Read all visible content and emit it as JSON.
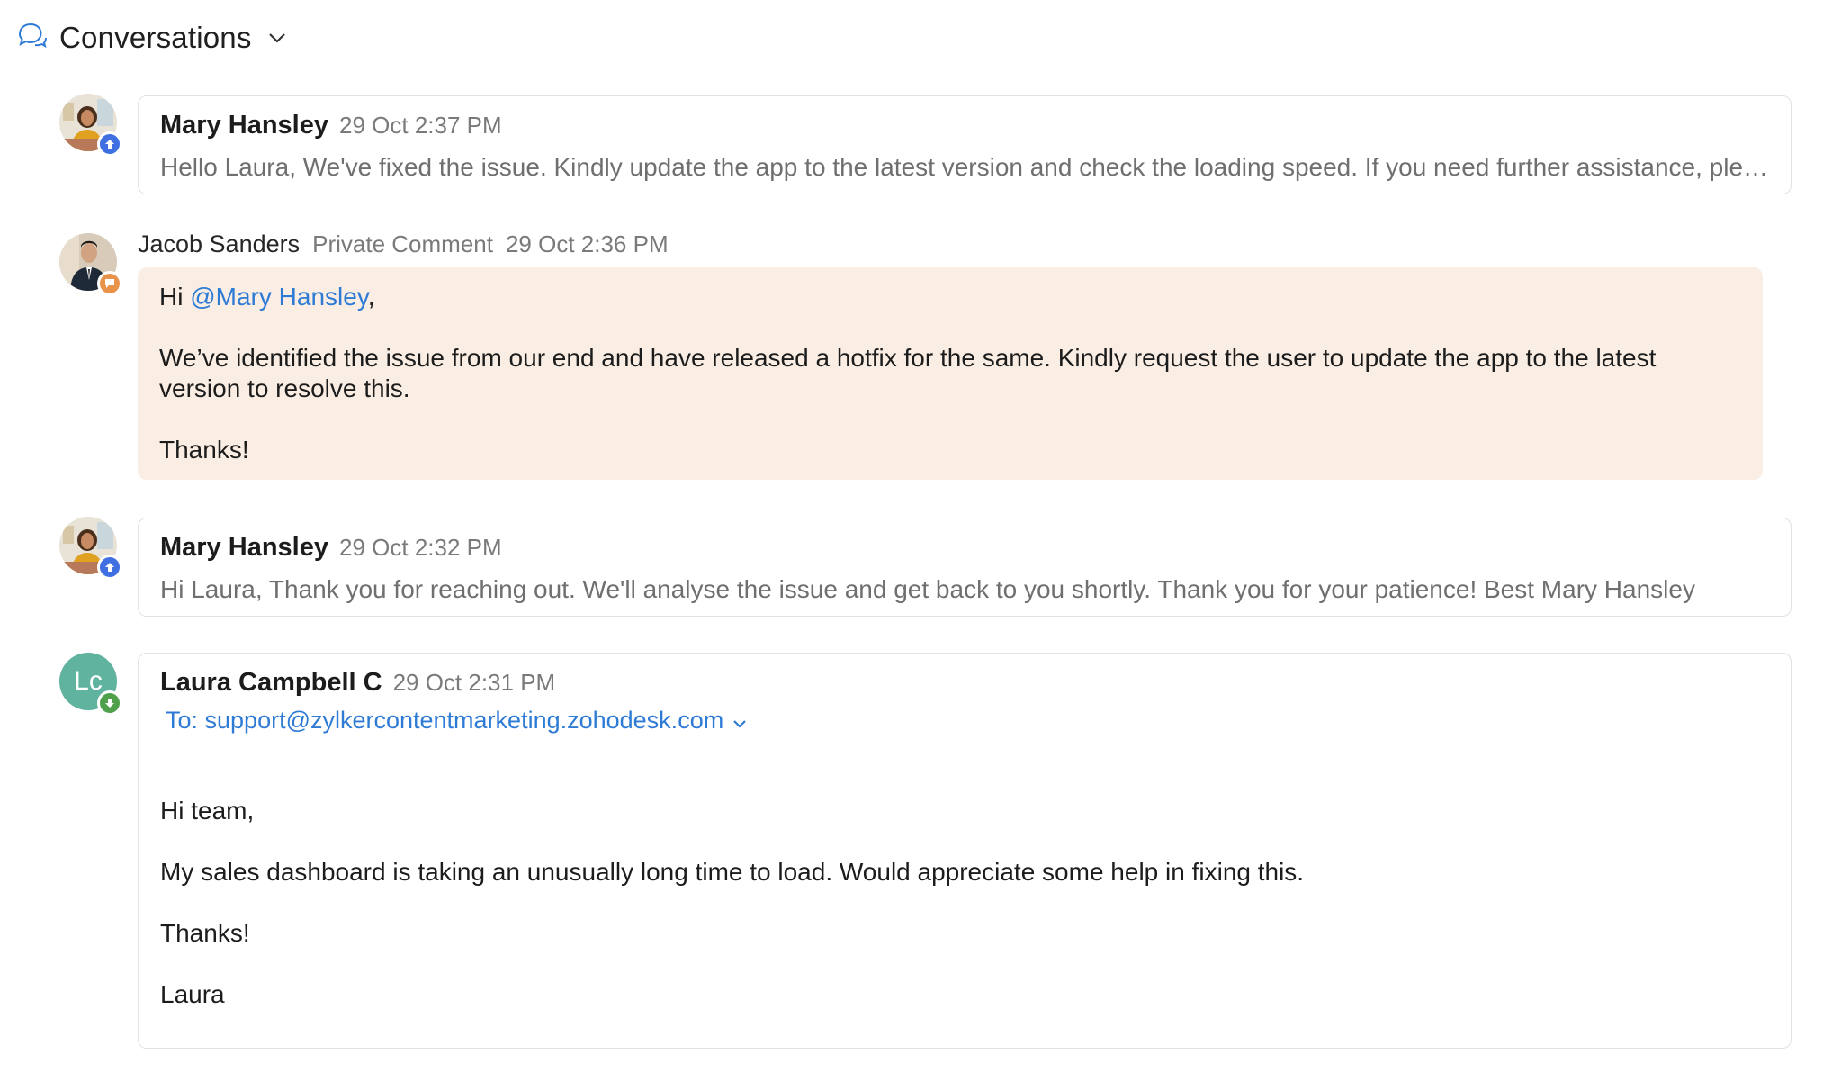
{
  "header": {
    "title": "Conversations"
  },
  "messages": [
    {
      "author": "Mary Hansley",
      "time": "29 Oct 2:37 PM",
      "snippet": "Hello Laura, We've fixed the issue. Kindly update the app to the latest version and check the loading speed. If you need further assistance, please let us know."
    },
    {
      "author": "Jacob Sanders",
      "label": "Private Comment",
      "time": "29 Oct 2:36 PM",
      "greeting_prefix": "Hi ",
      "mention": "@Mary Hansley",
      "greeting_suffix": ",",
      "body": "We’ve identified the issue from our end and have released a hotfix for the same. Kindly request the user to update the app to the latest version to resolve this.",
      "signoff": "Thanks!"
    },
    {
      "author": "Mary Hansley",
      "time": "29 Oct 2:32 PM",
      "snippet": "Hi Laura, Thank you for reaching out. We'll analyse the issue and get back to you shortly. Thank you for your patience! Best Mary Hansley"
    },
    {
      "author": "Laura Campbell C",
      "initials": "Lc",
      "time": "29 Oct 2:31 PM",
      "to": "To: support@zylkercontentmarketing.zohodesk.com",
      "lines": [
        "Hi team,",
        "My sales dashboard is taking an unusually long time to load. Would appreciate some help in fixing this.",
        "Thanks!",
        "Laura"
      ]
    }
  ],
  "colors": {
    "accent": "#2e7bd6",
    "outgoing_badge": "#3f6fe0",
    "comment_badge": "#e8924a",
    "incoming_badge": "#4ea04a",
    "private_bg": "#faeee4",
    "avatar_teal": "#5fb39f"
  },
  "icons": {
    "header": "conversation-bubbles-icon",
    "dropdown": "chevron-down-icon",
    "outgoing": "arrow-up-badge-icon",
    "comment": "comment-badge-icon",
    "incoming": "arrow-down-badge-icon"
  }
}
